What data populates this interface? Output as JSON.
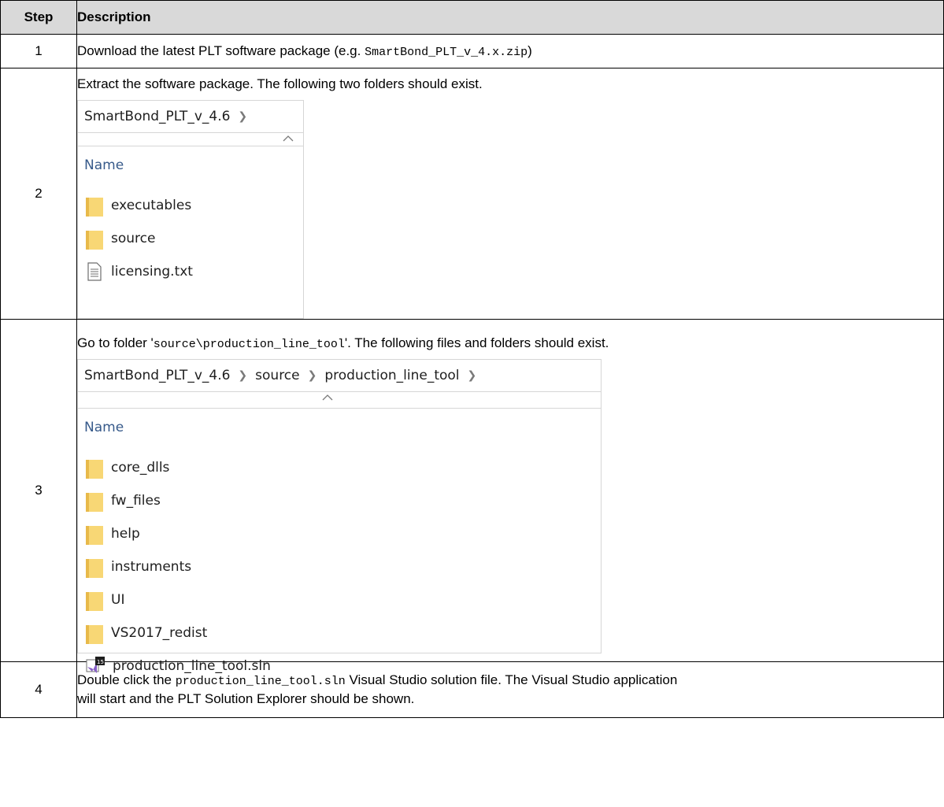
{
  "table": {
    "headers": {
      "step": "Step",
      "description": "Description"
    },
    "rows": [
      {
        "step": "1",
        "text_before": "Download the latest PLT software package (e.g. ",
        "code": "SmartBond_PLT_v_4.x.zip",
        "text_after": ")"
      },
      {
        "step": "2",
        "text": "Extract the software package. The following two folders should exist.",
        "explorer": {
          "breadcrumb": [
            "SmartBond_PLT_v_4.6"
          ],
          "column_header": "Name",
          "items": [
            {
              "name": "executables",
              "icon": "folder-icon"
            },
            {
              "name": "source",
              "icon": "folder-icon"
            },
            {
              "name": "licensing.txt",
              "icon": "text-file-icon"
            }
          ]
        }
      },
      {
        "step": "3",
        "text_before": "Go to folder '",
        "code": "source\\production_line_tool",
        "text_after": "'. The following files and folders should exist.",
        "explorer": {
          "breadcrumb": [
            "SmartBond_PLT_v_4.6",
            "source",
            "production_line_tool"
          ],
          "column_header": "Name",
          "items": [
            {
              "name": "core_dlls",
              "icon": "folder-icon"
            },
            {
              "name": "fw_files",
              "icon": "folder-icon"
            },
            {
              "name": "help",
              "icon": "folder-icon"
            },
            {
              "name": "instruments",
              "icon": "folder-icon"
            },
            {
              "name": "UI",
              "icon": "folder-icon"
            },
            {
              "name": "VS2017_redist",
              "icon": "folder-icon"
            },
            {
              "name": "production_line_tool.sln",
              "icon": "visual-studio-solution-icon"
            }
          ]
        }
      },
      {
        "step": "4",
        "text_before": "Double click the ",
        "code": "production_line_tool.sln",
        "text_after": " Visual Studio solution file. The Visual Studio application",
        "text_line2": "will start and the PLT Solution Explorer should be shown."
      }
    ]
  },
  "colors": {
    "header_bg": "#d9d9d9",
    "folder_yellow": "#f8d775",
    "name_header_blue": "#375a8a",
    "vs_purple": "#865fc5"
  }
}
